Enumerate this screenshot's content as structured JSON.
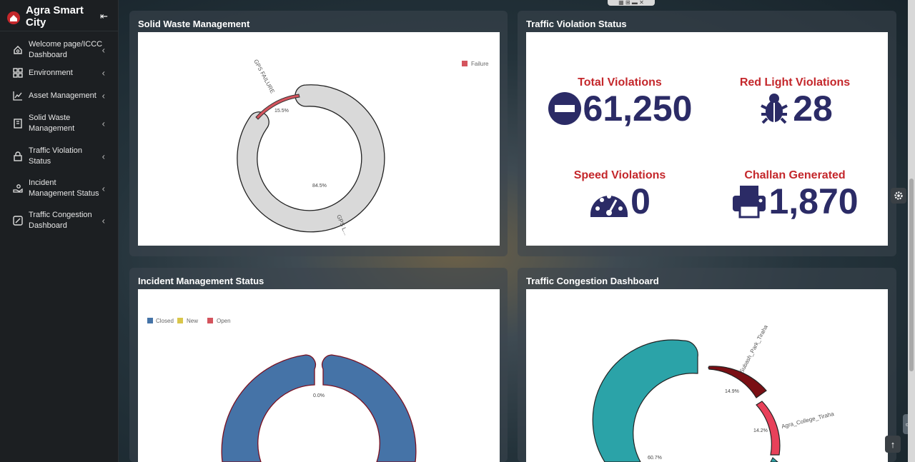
{
  "sidebar": {
    "brand": "Agra Smart City",
    "items": [
      {
        "label": "Welcome page/ICCC Dashboard",
        "icon": "home-icon"
      },
      {
        "label": "Environment",
        "icon": "grid-icon"
      },
      {
        "label": "Asset Management",
        "icon": "line-chart-icon"
      },
      {
        "label": "Solid Waste Management",
        "icon": "bookmark-icon"
      },
      {
        "label": "Traffic Violation Status",
        "icon": "lock-icon"
      },
      {
        "label": "Incident Management Status",
        "icon": "hand-icon"
      },
      {
        "label": "Traffic Congestion Dashboard",
        "icon": "edit-icon"
      }
    ]
  },
  "panels": {
    "swm": {
      "title": "Solid Waste Management"
    },
    "tv": {
      "title": "Traffic Violation Status"
    },
    "im": {
      "title": "Incident Management Status"
    },
    "tc": {
      "title": "Traffic Congestion Dashboard"
    }
  },
  "violations": {
    "total": {
      "title": "Total Violations",
      "value": "61,250"
    },
    "red": {
      "title": "Red Light Violations",
      "value": "28"
    },
    "speed": {
      "title": "Speed Violations",
      "value": "0"
    },
    "challan": {
      "title": "Challan Generated",
      "value": "1,870"
    }
  },
  "colors": {
    "accent_red": "#c4272b",
    "navy": "#2b2b66"
  },
  "chart_data": [
    {
      "type": "pie",
      "categories": [
        "GPS FAILURE",
        "GPS L..."
      ],
      "values": [
        15.5,
        84.5
      ],
      "value_labels": [
        "15.5%",
        "84.5%"
      ],
      "legend": [
        "Failure"
      ],
      "legend_position": "top-right",
      "colors": [
        "#d4545d",
        "#d9d9d9"
      ]
    },
    {
      "type": "pie",
      "categories": [
        "Closed",
        "New",
        "Open"
      ],
      "value_labels": [
        "0.0%"
      ],
      "legend": [
        "Closed",
        "New",
        "Open"
      ],
      "legend_position": "top-left",
      "colors": [
        "#4573a7",
        "#d9c64a",
        "#d4545d"
      ]
    },
    {
      "type": "pie",
      "categories": [
        "Subash_Park_Tiraha",
        "Agra_College_Tiraha",
        ""
      ],
      "values": [
        14.9,
        14.2,
        60.7
      ],
      "value_labels": [
        "14.9%",
        "14.2%",
        "60.7%"
      ],
      "colors": [
        "#7a0f14",
        "#e8415a",
        "#2ba3a8"
      ]
    }
  ]
}
